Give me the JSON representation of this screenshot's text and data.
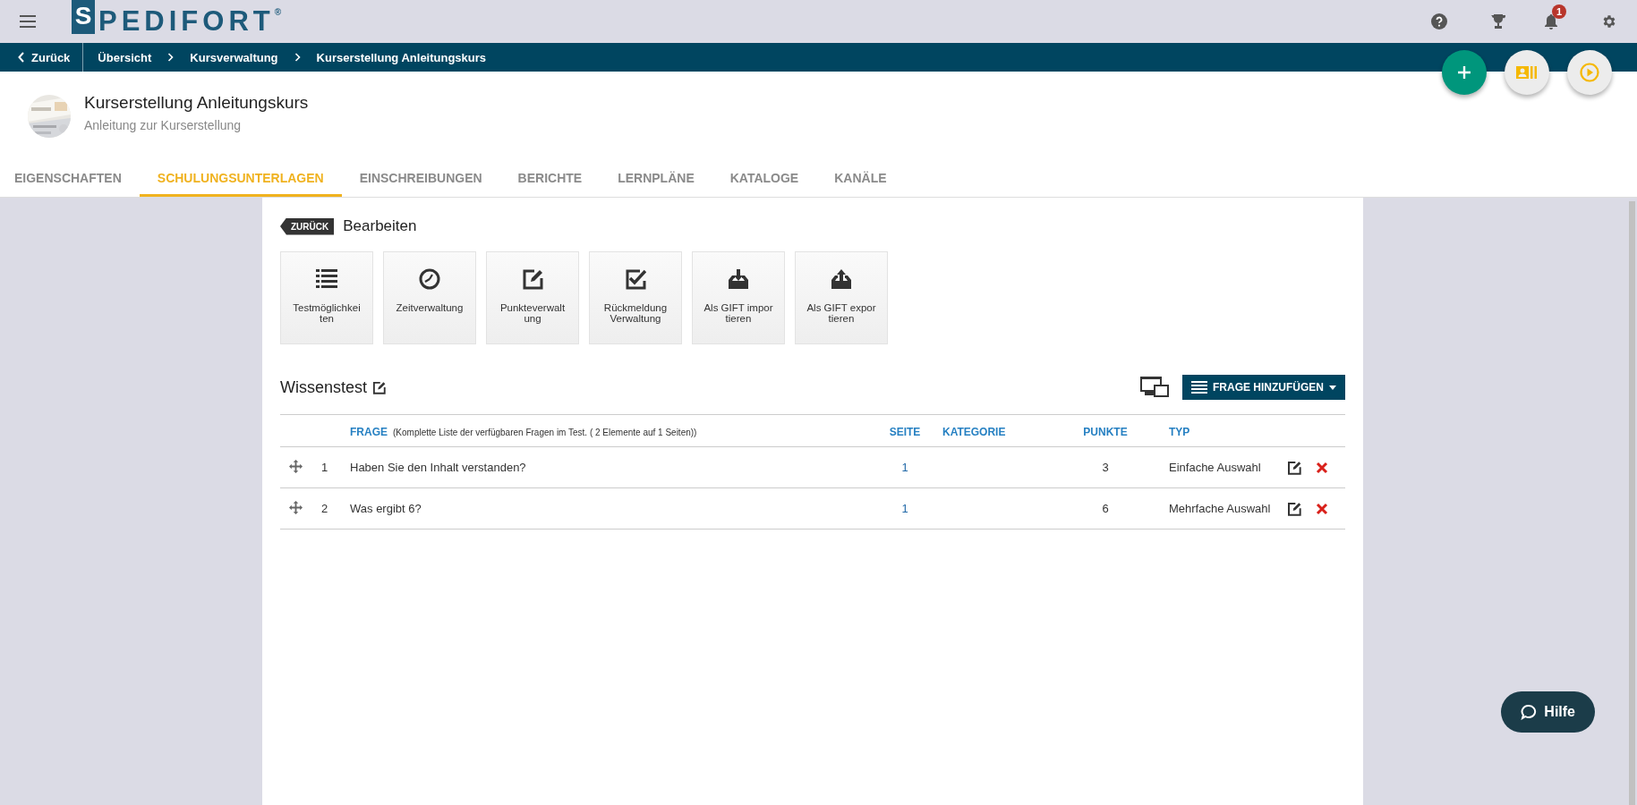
{
  "logo": {
    "badge_letter": "S",
    "text": "PEDIFORT",
    "mark": "®"
  },
  "notification_count": "1",
  "breadcrumb": {
    "back": "Zurück",
    "items": [
      "Übersicht",
      "Kursverwaltung",
      "Kurserstellung Anleitungskurs"
    ]
  },
  "course": {
    "title": "Kurserstellung Anleitungskurs",
    "subtitle": "Anleitung zur Kurserstellung"
  },
  "tabs": [
    {
      "label": "EIGENSCHAFTEN",
      "selected": false
    },
    {
      "label": "SCHULUNGSUNTERLAGEN",
      "selected": true
    },
    {
      "label": "EINSCHREIBUNGEN",
      "selected": false
    },
    {
      "label": "BERICHTE",
      "selected": false
    },
    {
      "label": "LERNPLÄNE",
      "selected": false
    },
    {
      "label": "KATALOGE",
      "selected": false
    },
    {
      "label": "KANÄLE",
      "selected": false
    }
  ],
  "editor": {
    "back_tag": "ZURÜCK",
    "title": "Bearbeiten"
  },
  "tools": [
    {
      "label": "Testmöglichkeiten"
    },
    {
      "label": "Zeitverwaltung"
    },
    {
      "label": "Punkteverwaltung"
    },
    {
      "label": "Rückmeldung Verwaltung"
    },
    {
      "label": "Als GIFT importieren"
    },
    {
      "label": "Als GIFT exportieren"
    }
  ],
  "test": {
    "title": "Wissenstest",
    "add_button": "FRAGE HINZUFÜGEN"
  },
  "table": {
    "columns": [
      {
        "label": "FRAGE",
        "note": "(Komplette Liste der verfügbaren Fragen im Test. ( 2 Elemente auf 1 Seiten))"
      },
      {
        "label": "SEITE"
      },
      {
        "label": "KATEGORIE"
      },
      {
        "label": "PUNKTE"
      },
      {
        "label": "TYP"
      }
    ],
    "rows": [
      {
        "number": "1",
        "question": "Haben Sie den Inhalt verstanden?",
        "page": "1",
        "points": "3",
        "type": "Einfache Auswahl"
      },
      {
        "number": "2",
        "question": "Was ergibt 6?",
        "page": "1",
        "points": "6",
        "type": "Mehrfache Auswahl"
      }
    ]
  },
  "help_button": "Hilfe"
}
